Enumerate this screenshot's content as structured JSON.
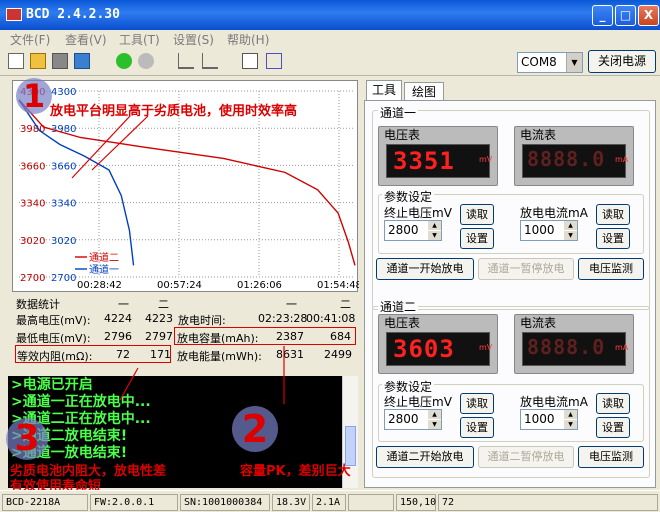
{
  "window": {
    "title": "BCD  2.4.2.30",
    "min": "_",
    "max": "□",
    "close": "X"
  },
  "menu": [
    "文件(F)",
    "查看(V)",
    "工具(T)",
    "设置(S)",
    "帮助(H)"
  ],
  "port": {
    "value": "COM8"
  },
  "power_button": "关闭电源",
  "chart_data": {
    "type": "line",
    "y_ticks_left": [
      "4300",
      "3980",
      "3660",
      "3340",
      "3020",
      "2700"
    ],
    "y_ticks_right": [
      "4300",
      "3980",
      "3660",
      "3340",
      "3020",
      "2700"
    ],
    "x_ticks": [
      "00:28:42",
      "00:57:24",
      "01:26:06",
      "01:54:48"
    ],
    "ylim": [
      2700,
      4300
    ],
    "xlim": [
      0,
      8213
    ],
    "series": [
      {
        "name": "通道一",
        "color": "#d00000",
        "x": [
          0,
          600,
          1500,
          3000,
          5000,
          6500,
          7300,
          7800,
          8050,
          8213
        ],
        "y": [
          4224,
          3990,
          3900,
          3820,
          3720,
          3600,
          3450,
          3250,
          3000,
          2800
        ]
      },
      {
        "name": "通道二",
        "color": "#0040c0",
        "x": [
          0,
          500,
          1000,
          1600,
          2200,
          2500,
          2700,
          2800
        ],
        "y": [
          4223,
          3960,
          3840,
          3740,
          3620,
          3400,
          3100,
          2800
        ]
      }
    ]
  },
  "stats": {
    "header": "数据统计",
    "ch1": "一",
    "ch2": "二",
    "rows": [
      {
        "label": "最高电压(mV):",
        "v1": "4224",
        "v2": "4223"
      },
      {
        "label": "最低电压(mV):",
        "v1": "2796",
        "v2": "2797"
      },
      {
        "label": "等效内阻(mΩ):",
        "v1": "72",
        "v2": "171"
      }
    ],
    "rrows": [
      {
        "label": "放电时间:",
        "v1": "02:23:28",
        "v2": "00:41:08"
      },
      {
        "label": "放电容量(mAh):",
        "v1": "2387",
        "v2": "684"
      },
      {
        "label": "放电能量(mWh):",
        "v1": "8631",
        "v2": "2499"
      }
    ]
  },
  "console": [
    ">电源已开启",
    ">通道一正在放电中...",
    ">通道二正在放电中...",
    ">通道二放电结束!",
    ">通道一放电结束!"
  ],
  "annotations": {
    "a1_num": "1",
    "a1_text": "放电平台明显高于劣质电池，使用时效率高",
    "a2_num": "2",
    "a2_text": "容量PK，差别巨大",
    "a3_num": "3",
    "a3_text1": "劣质电池内阻大，放电性差",
    "a3_text2": "有效使用寿命短"
  },
  "tabs": [
    "工具",
    "绘图"
  ],
  "ch1": {
    "title": "通道一",
    "volt_label": "电压表",
    "curr_label": "电流表",
    "volt_display": "3351",
    "volt_unit": "mV",
    "curr_display": "8888.0",
    "curr_unit": "mA",
    "params": "参数设定",
    "stop_label": "终止电压mV",
    "stop_value": "2800",
    "cur_label": "放电电流mA",
    "cur_value": "1000",
    "read": "读取",
    "set": "设置",
    "start": "通道一开始放电",
    "pause": "通道一暂停放电",
    "monitor": "电压监测"
  },
  "ch2": {
    "title": "通道二",
    "volt_label": "电压表",
    "curr_label": "电流表",
    "volt_display": "3603",
    "volt_unit": "mV",
    "curr_display": "8888.0",
    "curr_unit": "mA",
    "params": "参数设定",
    "stop_label": "终止电压mV",
    "stop_value": "2800",
    "cur_label": "放电电流mA",
    "cur_value": "1000",
    "read": "读取",
    "set": "设置",
    "start": "通道二开始放电",
    "pause": "通道二暂停放电",
    "monitor": "电压监测"
  },
  "status": [
    "BCD-2218A",
    "FW:2.0.0.1",
    "SN:1001000384",
    "18.3V",
    "2.1A",
    "",
    "150,10",
    "72"
  ]
}
